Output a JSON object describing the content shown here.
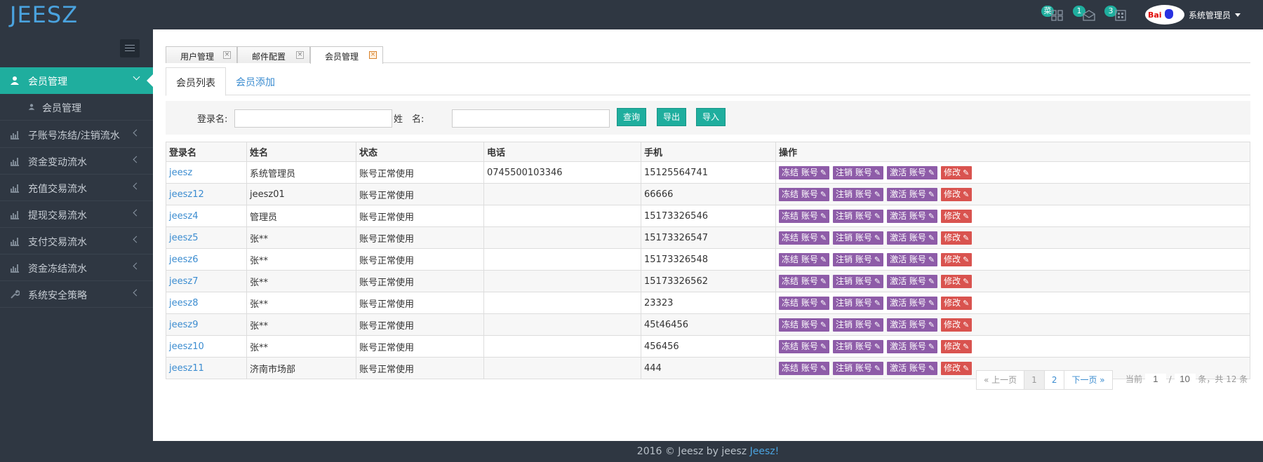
{
  "app": {
    "logo": "JEESZ"
  },
  "topbar": {
    "badges": [
      {
        "icon": "grid-icon",
        "count": "菜"
      },
      {
        "icon": "mail-icon",
        "count": "1"
      },
      {
        "icon": "building-icon",
        "count": "3"
      }
    ],
    "avatar_text": "Bai",
    "user_name": "系统管理员"
  },
  "sidebar": {
    "items": [
      {
        "label": "会员管理",
        "icon": "user-icon",
        "active": true
      },
      {
        "label": "子账号冻结/注销流水",
        "icon": "chart-icon"
      },
      {
        "label": "资金变动流水",
        "icon": "chart-icon"
      },
      {
        "label": "充值交易流水",
        "icon": "chart-icon"
      },
      {
        "label": "提现交易流水",
        "icon": "chart-icon"
      },
      {
        "label": "支付交易流水",
        "icon": "chart-icon"
      },
      {
        "label": "资金冻结流水",
        "icon": "chart-icon"
      },
      {
        "label": "系统安全策略",
        "icon": "wrench-icon"
      }
    ],
    "sub_item": {
      "label": "会员管理",
      "icon": "user-icon"
    }
  },
  "page_tabs": [
    {
      "label": "用户管理"
    },
    {
      "label": "邮件配置"
    },
    {
      "label": "会员管理",
      "active": true
    }
  ],
  "sub_tabs": [
    {
      "label": "会员列表",
      "active": true
    },
    {
      "label": "会员添加"
    }
  ],
  "search": {
    "login_label": "登录名:",
    "login_value": "",
    "name_label": "姓　名:",
    "name_value": "",
    "query_btn": "查询",
    "export_btn": "导出",
    "import_btn": "导入"
  },
  "table": {
    "headers": [
      "登录名",
      "姓名",
      "状态",
      "电话",
      "手机",
      "操作"
    ],
    "actions": {
      "freeze": "冻结 账号",
      "cancel": "注销 账号",
      "activate": "激活 账号",
      "edit": "修改"
    },
    "rows": [
      {
        "login": "jeesz",
        "name": "系统管理员",
        "status": "账号正常使用",
        "phone": "0745500103346",
        "mobile": "15125564741"
      },
      {
        "login": "jeesz12",
        "name": "jeesz01",
        "status": "账号正常使用",
        "phone": "",
        "mobile": "66666"
      },
      {
        "login": "jeesz4",
        "name": "管理员",
        "status": "账号正常使用",
        "phone": "",
        "mobile": "15173326546"
      },
      {
        "login": "jeesz5",
        "name": "张**",
        "status": "账号正常使用",
        "phone": "",
        "mobile": "15173326547"
      },
      {
        "login": "jeesz6",
        "name": "张**",
        "status": "账号正常使用",
        "phone": "",
        "mobile": "15173326548"
      },
      {
        "login": "jeesz7",
        "name": "张**",
        "status": "账号正常使用",
        "phone": "",
        "mobile": "15173326562"
      },
      {
        "login": "jeesz8",
        "name": "张**",
        "status": "账号正常使用",
        "phone": "",
        "mobile": "23323"
      },
      {
        "login": "jeesz9",
        "name": "张**",
        "status": "账号正常使用",
        "phone": "",
        "mobile": "45t46456"
      },
      {
        "login": "jeesz10",
        "name": "张**",
        "status": "账号正常使用",
        "phone": "",
        "mobile": "456456"
      },
      {
        "login": "jeesz11",
        "name": "济南市场部",
        "status": "账号正常使用",
        "phone": "",
        "mobile": "444"
      }
    ]
  },
  "pager": {
    "prev": "« 上一页",
    "pages": [
      "1",
      "2"
    ],
    "next": "下一页 »",
    "current_label": "当前",
    "current_page": "1",
    "sep": "/",
    "page_size": "10",
    "total_text": "条，共 12 条"
  },
  "footer": {
    "text": "2016 © Jeesz by jeesz",
    "highlight": "Jeesz!"
  },
  "colors": {
    "accent": "#1fae9e",
    "purple": "#8e5ca8",
    "red": "#d9534f",
    "link": "#3b8cd0",
    "dark": "#2f3742"
  }
}
